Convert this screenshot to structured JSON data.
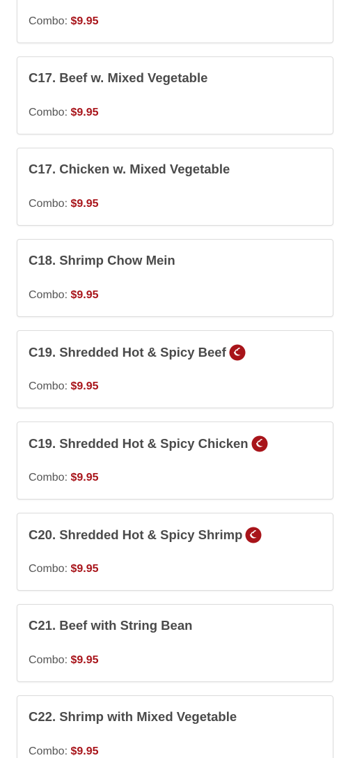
{
  "price_label": "Combo:",
  "accent_color": "#a8141a",
  "spicy_icon": "chili-pepper-icon",
  "items": [
    {
      "name": "",
      "combo_price": "$9.95",
      "spicy": false
    },
    {
      "name": "C17. Beef w. Mixed Vegetable",
      "combo_price": "$9.95",
      "spicy": false
    },
    {
      "name": "C17. Chicken w. Mixed Vegetable",
      "combo_price": "$9.95",
      "spicy": false
    },
    {
      "name": "C18. Shrimp Chow Mein",
      "combo_price": "$9.95",
      "spicy": false
    },
    {
      "name": "C19. Shredded Hot & Spicy Beef",
      "combo_price": "$9.95",
      "spicy": true
    },
    {
      "name": "C19. Shredded Hot & Spicy Chicken",
      "combo_price": "$9.95",
      "spicy": true
    },
    {
      "name": "C20. Shredded Hot & Spicy Shrimp",
      "combo_price": "$9.95",
      "spicy": true
    },
    {
      "name": "C21. Beef with String Bean",
      "combo_price": "$9.95",
      "spicy": false
    },
    {
      "name": "C22. Shrimp with Mixed Vegetable",
      "combo_price": "$9.95",
      "spicy": false
    }
  ]
}
